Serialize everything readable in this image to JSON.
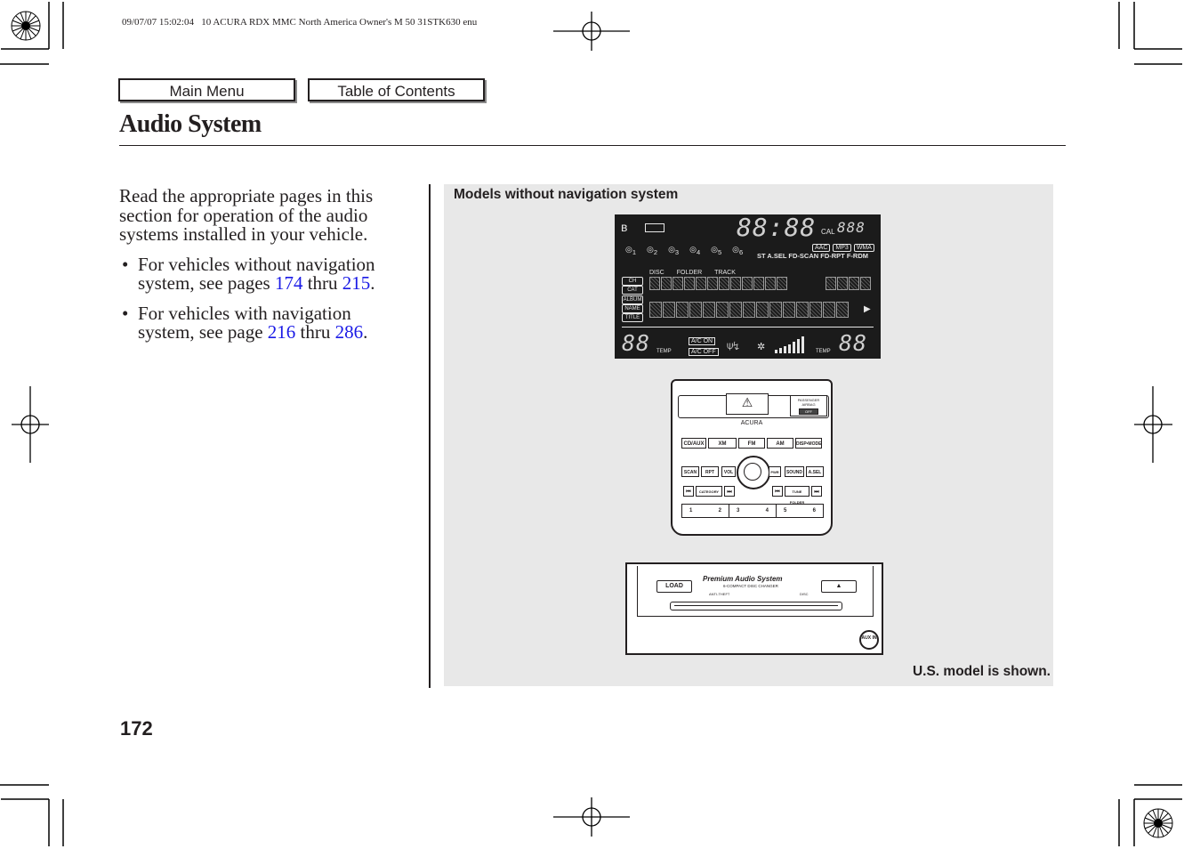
{
  "slug_line": "09/07/07 15:02:04   10 ACURA RDX MMC North America Owner's M 50 31STK630 enu",
  "nav": {
    "main_menu": "Main Menu",
    "table_of_contents": "Table of Contents"
  },
  "page_title": "Audio System",
  "intro": "Read the appropriate pages in this section for operation of the audio systems installed in your vehicle.",
  "bullets": [
    {
      "bullet": "•",
      "text_before": "For vehicles without navigation system, see pages ",
      "link1": "174",
      "middle": " thru ",
      "link2": "215",
      "text_after": "."
    },
    {
      "bullet": "•",
      "text_before": "For vehicles with navigation system, see page ",
      "link1": "216",
      "middle": " thru ",
      "link2": "286",
      "text_after": "."
    }
  ],
  "figure": {
    "caption": "Models without navigation system",
    "note": "U.S. model is shown.",
    "display": {
      "clock": "88:88",
      "cal_label": "CAL",
      "cal_digits": "888",
      "disc_numbers": [
        "1",
        "2",
        "3",
        "4",
        "5",
        "6"
      ],
      "format_badges": [
        "AAC",
        "MP3",
        "WMA"
      ],
      "modes": "ST A.SEL FD-SCAN FD-RPT F-RDM",
      "column_labels": [
        "DISC",
        "FOLDER",
        "TRACK"
      ],
      "side_labels": [
        "CH",
        "CAT",
        "ALBUM",
        "NAME",
        "TITLE"
      ],
      "temp_left": "88",
      "temp_right": "88",
      "temp_label": "TEMP",
      "ac_on": "A/C ON",
      "ac_off": "A/C OFF",
      "play_indicator": "▶"
    },
    "head_unit": {
      "brand": "ACURA",
      "airbag_label": "PASSENGER AIRBAG",
      "airbag_state": "OFF",
      "hazard_icon": "⚠",
      "row1": [
        "CD/AUX",
        "XM",
        "FM",
        "AM",
        "DISP•MODE"
      ],
      "row2_left": [
        "SCAN",
        "RPT",
        "VOL"
      ],
      "row2_right": [
        "PWR",
        "SOUND",
        "A.SEL"
      ],
      "seek_left": [
        "⏮",
        "CATEGORY",
        "⏭"
      ],
      "seek_right": [
        "⏮",
        "TUNE FOLDER",
        "⏭"
      ],
      "presets": [
        "1",
        "2",
        "3",
        "4",
        "5",
        "6"
      ]
    },
    "changer": {
      "load": "LOAD",
      "eject": "▲",
      "title": "Premium Audio System",
      "subtitle": "6-COMPACT DISC CHANGER",
      "indicator_left": "ANTI-THEFT",
      "indicator_right": "DISC",
      "aux": "AUX IN"
    }
  },
  "page_number": "172"
}
